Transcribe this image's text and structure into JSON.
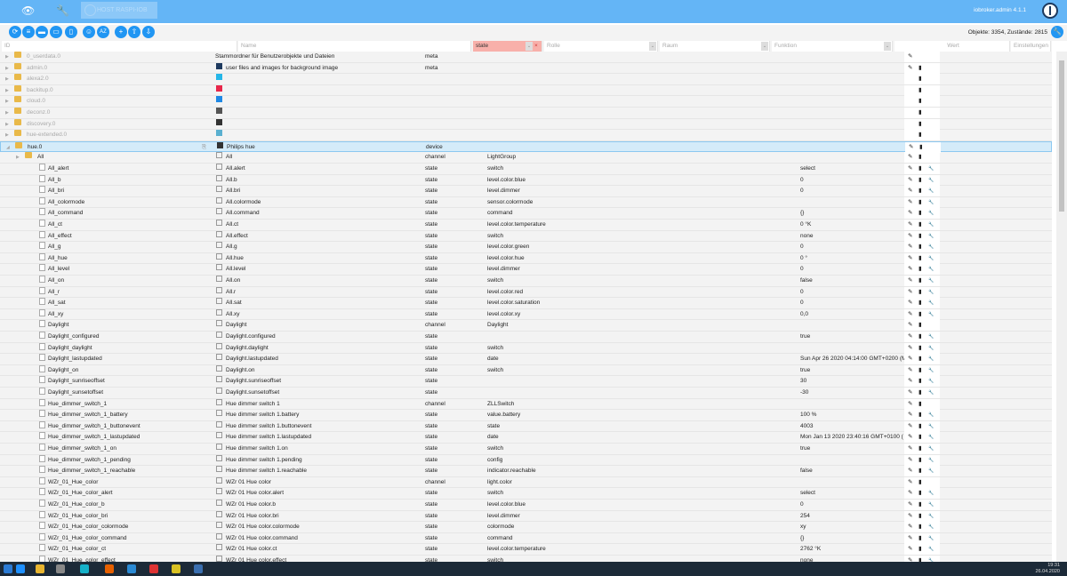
{
  "header": {
    "host": "HOST RASPI-IOB",
    "version": "iobroker.admin 4.1.1"
  },
  "toolbar": {
    "counts": "Objekte: 3354, Zustände: 2815"
  },
  "columns": {
    "id": "ID",
    "name": "Name",
    "type_filter": "state",
    "role": "Rolle",
    "room": "Raum",
    "function": "Funktion",
    "value": "Wert",
    "settings": "Einstellungen"
  },
  "rows": [
    {
      "id": "0_userdata.0",
      "name": "Stammordner für Benutzerobjekte und Dateien",
      "type": "meta",
      "role": "",
      "value": "",
      "dim": true,
      "folder": true,
      "btns": "p",
      "icon": ""
    },
    {
      "id": "admin.0",
      "name": "user files and images for background image",
      "type": "meta",
      "role": "",
      "value": "",
      "dim": true,
      "folder": true,
      "btns": "pt",
      "icon": "#1e3a5f"
    },
    {
      "id": "alexa2.0",
      "name": "",
      "type": "",
      "role": "",
      "value": "",
      "dim": true,
      "folder": true,
      "btns": "t",
      "icon": "#25b6e8"
    },
    {
      "id": "backitup.0",
      "name": "",
      "type": "",
      "role": "",
      "value": "",
      "dim": true,
      "folder": true,
      "btns": "t",
      "icon": "#e8264a"
    },
    {
      "id": "cloud.0",
      "name": "",
      "type": "",
      "role": "",
      "value": "",
      "dim": true,
      "folder": true,
      "btns": "t",
      "icon": "#1e88e5"
    },
    {
      "id": "deconz.0",
      "name": "",
      "type": "",
      "role": "",
      "value": "",
      "dim": true,
      "folder": true,
      "btns": "t",
      "icon": "#555555"
    },
    {
      "id": "discovery.0",
      "name": "",
      "type": "",
      "role": "",
      "value": "",
      "dim": true,
      "folder": true,
      "btns": "t",
      "icon": "#333333"
    },
    {
      "id": "hue-extended.0",
      "name": "",
      "type": "",
      "role": "",
      "value": "",
      "dim": true,
      "folder": true,
      "btns": "t",
      "icon": "#5ab0d0"
    },
    {
      "id": "hue.0",
      "name": "Philips hue",
      "type": "device",
      "role": "",
      "value": "",
      "sel": true,
      "folder": true,
      "btns": "pt",
      "icon": "#333333"
    },
    {
      "id": "All",
      "name": "All",
      "type": "channel",
      "role": "LightGroup",
      "value": "",
      "folder": true,
      "level": 1,
      "btns": "pt"
    },
    {
      "id": "All_alert",
      "name": "All.alert",
      "type": "state",
      "role": "switch",
      "value": "select",
      "level": 2,
      "btns": "ptw"
    },
    {
      "id": "All_b",
      "name": "All.b",
      "type": "state",
      "role": "level.color.blue",
      "value": "0",
      "level": 2,
      "btns": "ptw"
    },
    {
      "id": "All_bri",
      "name": "All.bri",
      "type": "state",
      "role": "level.dimmer",
      "value": "0",
      "level": 2,
      "btns": "ptw"
    },
    {
      "id": "All_colormode",
      "name": "All.colormode",
      "type": "state",
      "role": "sensor.colormode",
      "value": "",
      "level": 2,
      "btns": "ptw"
    },
    {
      "id": "All_command",
      "name": "All.command",
      "type": "state",
      "role": "command",
      "value": "{}",
      "level": 2,
      "btns": "ptw"
    },
    {
      "id": "All_ct",
      "name": "All.ct",
      "type": "state",
      "role": "level.color.temperature",
      "value": "0 °K",
      "level": 2,
      "btns": "ptw"
    },
    {
      "id": "All_effect",
      "name": "All.effect",
      "type": "state",
      "role": "switch",
      "value": "none",
      "level": 2,
      "btns": "ptw"
    },
    {
      "id": "All_g",
      "name": "All.g",
      "type": "state",
      "role": "level.color.green",
      "value": "0",
      "level": 2,
      "btns": "ptw"
    },
    {
      "id": "All_hue",
      "name": "All.hue",
      "type": "state",
      "role": "level.color.hue",
      "value": "0 °",
      "level": 2,
      "btns": "ptw"
    },
    {
      "id": "All_level",
      "name": "All.level",
      "type": "state",
      "role": "level.dimmer",
      "value": "0",
      "level": 2,
      "btns": "ptw"
    },
    {
      "id": "All_on",
      "name": "All.on",
      "type": "state",
      "role": "switch",
      "value": "false",
      "level": 2,
      "btns": "ptw"
    },
    {
      "id": "All_r",
      "name": "All.r",
      "type": "state",
      "role": "level.color.red",
      "value": "0",
      "level": 2,
      "btns": "ptw"
    },
    {
      "id": "All_sat",
      "name": "All.sat",
      "type": "state",
      "role": "level.color.saturation",
      "value": "0",
      "level": 2,
      "btns": "ptw"
    },
    {
      "id": "All_xy",
      "name": "All.xy",
      "type": "state",
      "role": "level.color.xy",
      "value": "0,0",
      "level": 2,
      "btns": "ptw"
    },
    {
      "id": "Daylight",
      "name": "Daylight",
      "type": "channel",
      "role": "Daylight",
      "value": "",
      "level": 2,
      "btns": "pt"
    },
    {
      "id": "Daylight_configured",
      "name": "Daylight.configured",
      "type": "state",
      "role": "",
      "value": "true",
      "level": 2,
      "btns": "ptw"
    },
    {
      "id": "Daylight_daylight",
      "name": "Daylight.daylight",
      "type": "state",
      "role": "switch",
      "value": "",
      "level": 2,
      "btns": "ptw"
    },
    {
      "id": "Daylight_lastupdated",
      "name": "Daylight.lastupdated",
      "type": "state",
      "role": "date",
      "value": "Sun Apr 26 2020 04:14:00 GMT+0200 (M",
      "level": 2,
      "btns": "ptw"
    },
    {
      "id": "Daylight_on",
      "name": "Daylight.on",
      "type": "state",
      "role": "switch",
      "value": "true",
      "level": 2,
      "btns": "ptw"
    },
    {
      "id": "Daylight_sunriseoffset",
      "name": "Daylight.sunriseoffset",
      "type": "state",
      "role": "",
      "value": "30",
      "level": 2,
      "btns": "ptw"
    },
    {
      "id": "Daylight_sunsetoffset",
      "name": "Daylight.sunsetoffset",
      "type": "state",
      "role": "",
      "value": "-30",
      "level": 2,
      "btns": "ptw"
    },
    {
      "id": "Hue_dimmer_switch_1",
      "name": "Hue dimmer switch 1",
      "type": "channel",
      "role": "ZLLSwitch",
      "value": "",
      "level": 2,
      "btns": "pt"
    },
    {
      "id": "Hue_dimmer_switch_1_battery",
      "name": "Hue dimmer switch 1.battery",
      "type": "state",
      "role": "value.battery",
      "value": "100 %",
      "level": 2,
      "btns": "ptw"
    },
    {
      "id": "Hue_dimmer_switch_1_buttonevent",
      "name": "Hue dimmer switch 1.buttonevent",
      "type": "state",
      "role": "state",
      "value": "4003",
      "level": 2,
      "btns": "ptw"
    },
    {
      "id": "Hue_dimmer_switch_1_lastupdated",
      "name": "Hue dimmer switch 1.lastupdated",
      "type": "state",
      "role": "date",
      "value": "Mon Jan 13 2020 23:40:16 GMT+0100 (",
      "level": 2,
      "btns": "ptw"
    },
    {
      "id": "Hue_dimmer_switch_1_on",
      "name": "Hue dimmer switch 1.on",
      "type": "state",
      "role": "switch",
      "value": "true",
      "level": 2,
      "btns": "ptw"
    },
    {
      "id": "Hue_dimmer_switch_1_pending",
      "name": "Hue dimmer switch 1.pending",
      "type": "state",
      "role": "config",
      "value": "",
      "level": 2,
      "btns": "ptw"
    },
    {
      "id": "Hue_dimmer_switch_1_reachable",
      "name": "Hue dimmer switch 1.reachable",
      "type": "state",
      "role": "indicator.reachable",
      "value": "false",
      "level": 2,
      "btns": "ptw"
    },
    {
      "id": "WZr_01_Hue_color",
      "name": "WZr 01 Hue color",
      "type": "channel",
      "role": "light.color",
      "value": "",
      "level": 2,
      "btns": "pt"
    },
    {
      "id": "WZr_01_Hue_color_alert",
      "name": "WZr 01 Hue color.alert",
      "type": "state",
      "role": "switch",
      "value": "select",
      "level": 2,
      "btns": "ptw"
    },
    {
      "id": "WZr_01_Hue_color_b",
      "name": "WZr 01 Hue color.b",
      "type": "state",
      "role": "level.color.blue",
      "value": "0",
      "level": 2,
      "btns": "ptw"
    },
    {
      "id": "WZr_01_Hue_color_bri",
      "name": "WZr 01 Hue color.bri",
      "type": "state",
      "role": "level.dimmer",
      "value": "254",
      "level": 2,
      "btns": "ptw"
    },
    {
      "id": "WZr_01_Hue_color_colormode",
      "name": "WZr 01 Hue color.colormode",
      "type": "state",
      "role": "colormode",
      "value": "xy",
      "level": 2,
      "btns": "ptw"
    },
    {
      "id": "WZr_01_Hue_color_command",
      "name": "WZr 01 Hue color.command",
      "type": "state",
      "role": "command",
      "value": "{}",
      "level": 2,
      "btns": "ptw"
    },
    {
      "id": "WZr_01_Hue_color_ct",
      "name": "WZr 01 Hue color.ct",
      "type": "state",
      "role": "level.color.temperature",
      "value": "2762 °K",
      "level": 2,
      "btns": "ptw"
    },
    {
      "id": "WZr_01_Hue_color_effect",
      "name": "WZr 01 Hue color.effect",
      "type": "state",
      "role": "switch",
      "value": "none",
      "level": 2,
      "btns": "ptw"
    }
  ],
  "taskbar": {
    "time": "19:31",
    "date": "26.04.2020"
  }
}
